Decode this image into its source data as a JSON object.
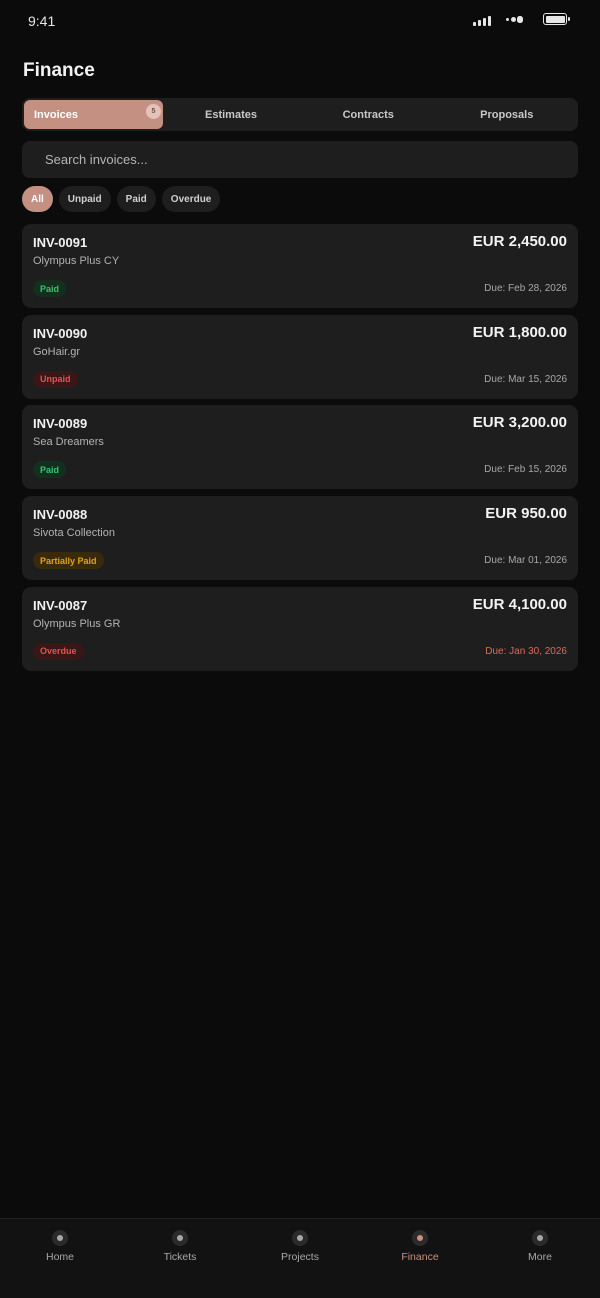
{
  "status_bar": {
    "time": "9:41"
  },
  "header": {
    "title": "Finance"
  },
  "tabs": [
    {
      "label": "Invoices",
      "badge": "5",
      "active": true
    },
    {
      "label": "Estimates"
    },
    {
      "label": "Contracts"
    },
    {
      "label": "Proposals"
    }
  ],
  "search": {
    "placeholder": "Search invoices..."
  },
  "filters": [
    {
      "label": "All",
      "active": true
    },
    {
      "label": "Unpaid"
    },
    {
      "label": "Paid"
    },
    {
      "label": "Overdue"
    }
  ],
  "invoices": [
    {
      "number": "INV-0091",
      "client": "Olympus Plus CY",
      "amount": "EUR 2,450.00",
      "status": "Paid",
      "due": "Due: Feb 28, 2026"
    },
    {
      "number": "INV-0090",
      "client": "GoHair.gr",
      "amount": "EUR 1,800.00",
      "status": "Unpaid",
      "due": "Due: Mar 15, 2026"
    },
    {
      "number": "INV-0089",
      "client": "Sea Dreamers",
      "amount": "EUR 3,200.00",
      "status": "Paid",
      "due": "Due: Feb 15, 2026"
    },
    {
      "number": "INV-0088",
      "client": "Sivota Collection",
      "amount": "EUR 950.00",
      "status": "Partially Paid",
      "due": "Due: Mar 01, 2026"
    },
    {
      "number": "INV-0087",
      "client": "Olympus Plus GR",
      "amount": "EUR 4,100.00",
      "status": "Overdue",
      "due": "Due: Jan 30, 2026"
    }
  ],
  "bottom_nav": [
    {
      "label": "Home",
      "icon": "home-icon"
    },
    {
      "label": "Tickets",
      "icon": "tickets-icon"
    },
    {
      "label": "Projects",
      "icon": "projects-icon"
    },
    {
      "label": "Finance",
      "icon": "finance-icon",
      "active": true
    },
    {
      "label": "More",
      "icon": "more-icon"
    }
  ],
  "colors": {
    "background": "#0b0b0b",
    "surface": "#1e1e1e",
    "accent": "#c39082",
    "paid": "#38c470",
    "unpaid": "#e05454",
    "partial": "#e6a21b",
    "overdue": "#e05454"
  }
}
